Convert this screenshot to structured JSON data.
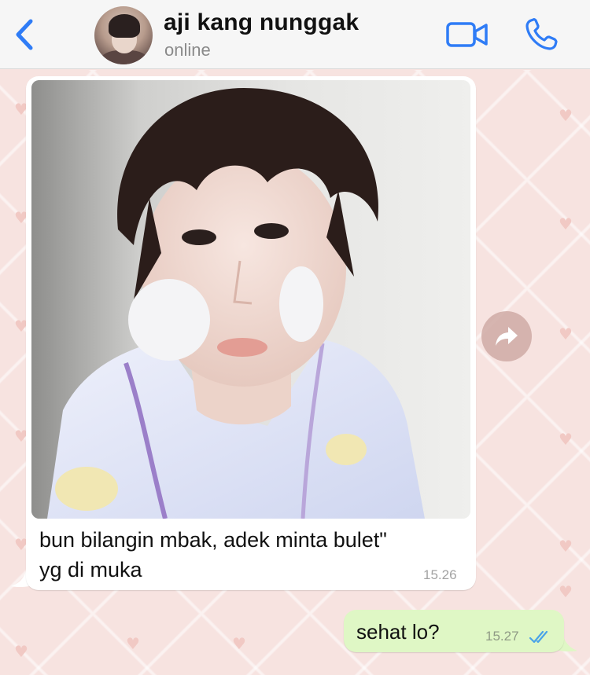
{
  "header": {
    "contact_name": "aji kang nunggak",
    "status": "online",
    "back_icon": "chevron-left-icon",
    "video_icon": "video-camera-icon",
    "call_icon": "phone-icon",
    "accent_color": "#2f7cf6"
  },
  "chat": {
    "wallpaper_color": "#f7e3e0",
    "messages": [
      {
        "direction": "incoming",
        "type": "photo",
        "caption": "bun bilangin mbak, adek minta bulet\" yg di muka",
        "caption_line1": "bun bilangin mbak, adek minta bulet\"",
        "caption_line2": "yg di muka",
        "time": "15.26",
        "bubble_color": "#ffffff"
      },
      {
        "direction": "outgoing",
        "type": "text",
        "text": "sehat lo?",
        "time": "15.27",
        "read_status": "read",
        "bubble_color": "#dff7c5"
      }
    ],
    "forward_icon": "share-arrow-icon"
  }
}
